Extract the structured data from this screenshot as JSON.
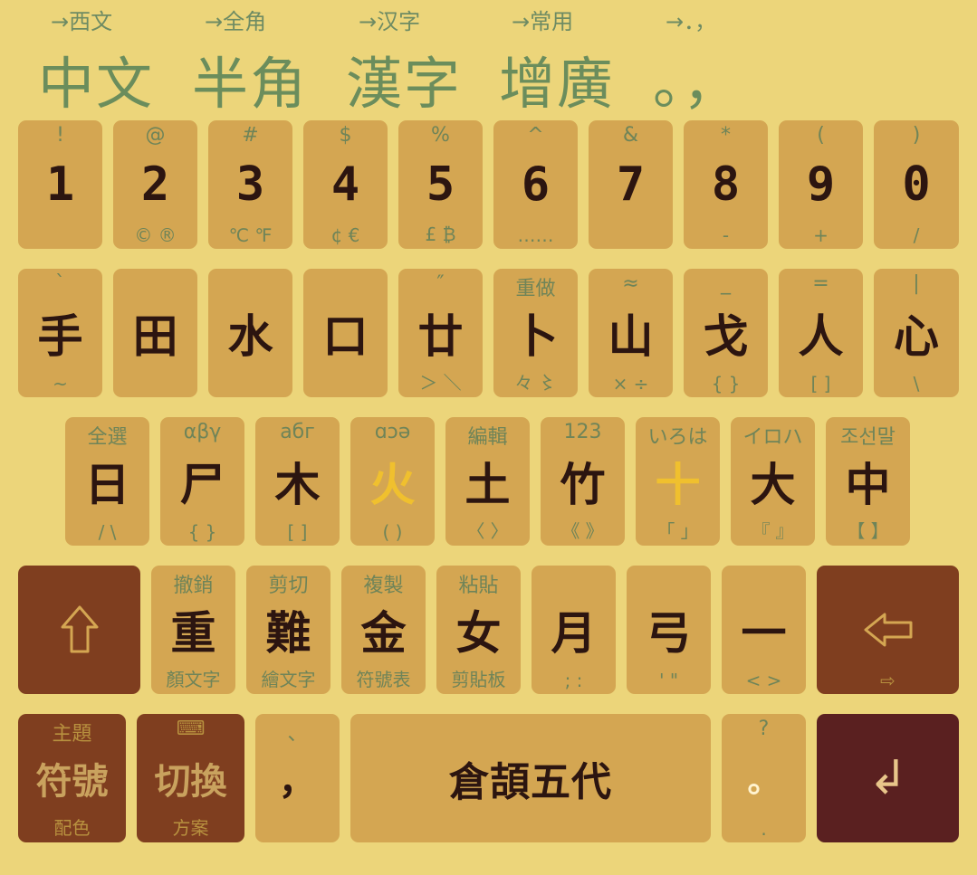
{
  "toolbar": [
    {
      "hint": "→西文",
      "label": "中文"
    },
    {
      "hint": "→全角",
      "label": "半角"
    },
    {
      "hint": "→汉字",
      "label": "漢字"
    },
    {
      "hint": "→常用",
      "label": "增廣"
    },
    {
      "hint": "→．，",
      "label": "。，"
    }
  ],
  "row1": [
    {
      "top": "!",
      "main": "1",
      "bot": ""
    },
    {
      "top": "@",
      "main": "2",
      "bot": "© ®"
    },
    {
      "top": "#",
      "main": "3",
      "bot": "℃ ℉"
    },
    {
      "top": "$",
      "main": "4",
      "bot": "¢ €"
    },
    {
      "top": "%",
      "main": "5",
      "bot": "£ ₿"
    },
    {
      "top": "^",
      "main": "6",
      "bot": "……"
    },
    {
      "top": "&",
      "main": "7",
      "bot": ""
    },
    {
      "top": "*",
      "main": "8",
      "bot": "-"
    },
    {
      "top": "(",
      "main": "9",
      "bot": "+"
    },
    {
      "top": ")",
      "main": "0",
      "bot": "/"
    }
  ],
  "row2": [
    {
      "top": "`",
      "main": "手",
      "bot": "~"
    },
    {
      "top": "",
      "main": "田",
      "bot": ""
    },
    {
      "top": "",
      "main": "水",
      "bot": ""
    },
    {
      "top": "",
      "main": "口",
      "bot": ""
    },
    {
      "top": "″",
      "main": "廿",
      "bot": "＞ ＼"
    },
    {
      "top": "重做",
      "main": "卜",
      "bot": "々 〻"
    },
    {
      "top": "≈",
      "main": "山",
      "bot": "× ÷"
    },
    {
      "top": "_",
      "main": "戈",
      "bot": "{ }"
    },
    {
      "top": "=",
      "main": "人",
      "bot": "[ ]"
    },
    {
      "top": "|",
      "main": "心",
      "bot": "\\"
    }
  ],
  "row3": [
    {
      "top": "全選",
      "main": "日",
      "bot": "/ \\"
    },
    {
      "top": "αβγ",
      "main": "尸",
      "bot": "{ }"
    },
    {
      "top": "абг",
      "main": "木",
      "bot": "[ ]"
    },
    {
      "top": "ɑɔə",
      "main": "火",
      "bot": "( )"
    },
    {
      "top": "編輯",
      "main": "土",
      "bot": "〈 〉"
    },
    {
      "top": "123",
      "main": "竹",
      "bot": "《 》"
    },
    {
      "top": "いろは",
      "main": "十",
      "bot": "「 」"
    },
    {
      "top": "イロハ",
      "main": "大",
      "bot": "『 』"
    },
    {
      "top": "조선말",
      "main": "中",
      "bot": "【 】"
    }
  ],
  "row4": [
    {
      "top": "撤銷",
      "main": "重",
      "bot": "顏文字"
    },
    {
      "top": "剪切",
      "main": "難",
      "bot": "繪文字"
    },
    {
      "top": "複製",
      "main": "金",
      "bot": "符號表"
    },
    {
      "top": "粘貼",
      "main": "女",
      "bot": "剪貼板"
    },
    {
      "top": "",
      "main": "月",
      "bot": "; :"
    },
    {
      "top": "",
      "main": "弓",
      "bot": "' \""
    },
    {
      "top": "",
      "main": "一",
      "bot": "< >"
    }
  ],
  "row5": {
    "symbols": {
      "top": "主題",
      "main": "符號",
      "bot": "配色"
    },
    "switch": {
      "top": "⌨",
      "main": "切換",
      "bot": "方案"
    },
    "comma": {
      "top": "、",
      "main": "，",
      "bot": ""
    },
    "space": {
      "main": "倉頡五代"
    },
    "period": {
      "top": "?",
      "main": "。",
      "bot": "."
    },
    "enter": {
      "main": "↲"
    }
  },
  "backspace_hint": "⇨",
  "colors": {
    "background": "#ecd57a",
    "key": "#d4a652",
    "dark_key": "#7f3e1f",
    "enter_key": "#5a2020",
    "hint_text": "#6f8458",
    "toolbar_text": "#6b8d5c",
    "highlight": "#f0c02e"
  },
  "icons": {
    "shift": "shift-arrow-icon",
    "backspace": "backspace-arrow-icon",
    "enter": "enter-icon",
    "keyboard": "keyboard-icon"
  }
}
